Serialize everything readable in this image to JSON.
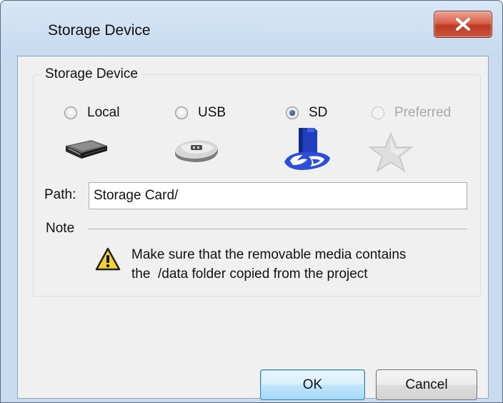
{
  "window": {
    "title": "Storage Device",
    "close_label": "X"
  },
  "group": {
    "title": "Storage Device",
    "options": [
      {
        "label": "Local",
        "checked": false,
        "enabled": true,
        "icon": "local-drive-icon"
      },
      {
        "label": "USB",
        "checked": false,
        "enabled": true,
        "icon": "usb-drive-icon"
      },
      {
        "label": "SD",
        "checked": true,
        "enabled": true,
        "icon": "sd-card-icon"
      },
      {
        "label": "Preferred",
        "checked": false,
        "enabled": false,
        "icon": "star-icon"
      }
    ]
  },
  "path": {
    "label": "Path:",
    "value": "Storage Card/"
  },
  "note": {
    "label": "Note",
    "line1": "Make sure that the removable media contains",
    "line2": "the  /data folder copied from the project",
    "icon": "warning-icon"
  },
  "buttons": {
    "ok": "OK",
    "cancel": "Cancel"
  },
  "colors": {
    "frame": "#c9dcef",
    "client": "#f0f0f0",
    "close_button": "#c9442c",
    "ok_button": "#bee6fd"
  }
}
